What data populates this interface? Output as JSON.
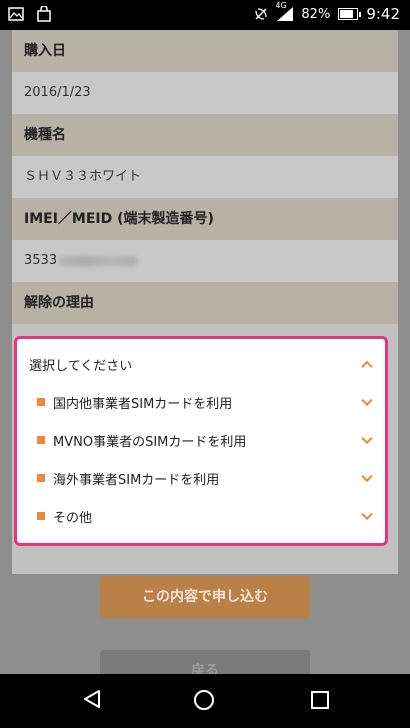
{
  "status_bar": {
    "network": "4G",
    "battery": "82%",
    "battery_level": 0.82,
    "time": "9:42"
  },
  "form": {
    "purchase_date_label": "購入日",
    "purchase_date_value": "2016/1/23",
    "model_label": "機種名",
    "model_value": "ＳＨＶ３３ホワイト",
    "imei_label": "IMEI／MEID (端末製造番号)",
    "imei_value_visible": "3533",
    "reason_label": "解除の理由"
  },
  "dropdown": {
    "placeholder": "選択してください",
    "options": [
      "国内他事業者SIMカードを利用",
      "MVNO事業者のSIMカードを利用",
      "海外事業者SIMカードを利用",
      "その他"
    ]
  },
  "buttons": {
    "submit_label": "この内容で申し込む",
    "back_label": "戻る"
  },
  "colors": {
    "highlight_border": "#e8347a",
    "accent": "#f0863a",
    "submit_button": "#b98047"
  }
}
